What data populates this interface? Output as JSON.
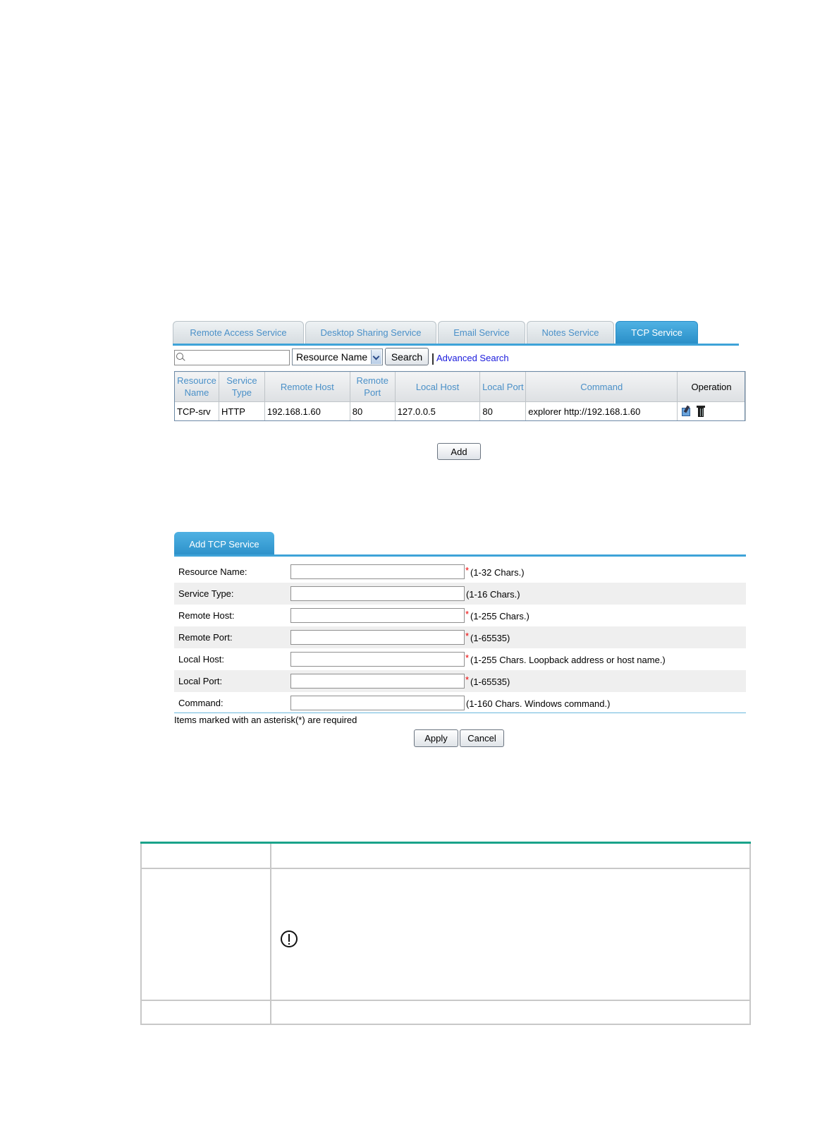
{
  "tabs": [
    {
      "label": "Remote Access Service",
      "active": false
    },
    {
      "label": "Desktop Sharing Service",
      "active": false
    },
    {
      "label": "Email Service",
      "active": false
    },
    {
      "label": "Notes Service",
      "active": false
    },
    {
      "label": "TCP Service",
      "active": true
    }
  ],
  "search": {
    "value": "",
    "field_selected": "Resource Name",
    "search_label": "Search",
    "advanced_label": "Advanced Search"
  },
  "table": {
    "headers": {
      "resource_name": "Resource Name",
      "service_type": "Service Type",
      "remote_host": "Remote Host",
      "remote_port": "Remote Port",
      "local_host": "Local Host",
      "local_port": "Local Port",
      "command": "Command",
      "operation": "Operation"
    },
    "rows": [
      {
        "resource_name": "TCP-srv",
        "service_type": "HTTP",
        "remote_host": "192.168.1.60",
        "remote_port": "80",
        "local_host": "127.0.0.5",
        "local_port": "80",
        "command": "explorer http://192.168.1.60",
        "operation_icons": [
          "modify-icon",
          "delete-icon"
        ]
      }
    ]
  },
  "add_label": "Add",
  "form": {
    "tab_label": "Add TCP Service",
    "fields": [
      {
        "label": "Resource Name:",
        "value": "",
        "required": true,
        "hint": "(1-32 Chars.)"
      },
      {
        "label": "Service Type:",
        "value": "",
        "required": false,
        "hint": "(1-16 Chars.)"
      },
      {
        "label": "Remote Host:",
        "value": "",
        "required": true,
        "hint": "(1-255 Chars.)"
      },
      {
        "label": "Remote Port:",
        "value": "",
        "required": true,
        "hint": "(1-65535)"
      },
      {
        "label": "Local Host:",
        "value": "",
        "required": true,
        "hint": "(1-255 Chars. Loopback address or host name.)"
      },
      {
        "label": "Local Port:",
        "value": "",
        "required": true,
        "hint": "(1-65535)"
      },
      {
        "label": "Command:",
        "value": "",
        "required": false,
        "hint": "(1-160 Chars. Windows command.)"
      }
    ],
    "required_marker": "*",
    "required_note": "Items marked with an asterisk(*) are required",
    "apply_label": "Apply",
    "cancel_label": "Cancel"
  },
  "colors": {
    "accent": "#3ea3d8",
    "tab_text": "#4a90c8",
    "link": "#1a1adc",
    "required": "#e00000",
    "doc_table_top": "#1aa38a"
  },
  "doc_icon": "warning-circle-icon"
}
